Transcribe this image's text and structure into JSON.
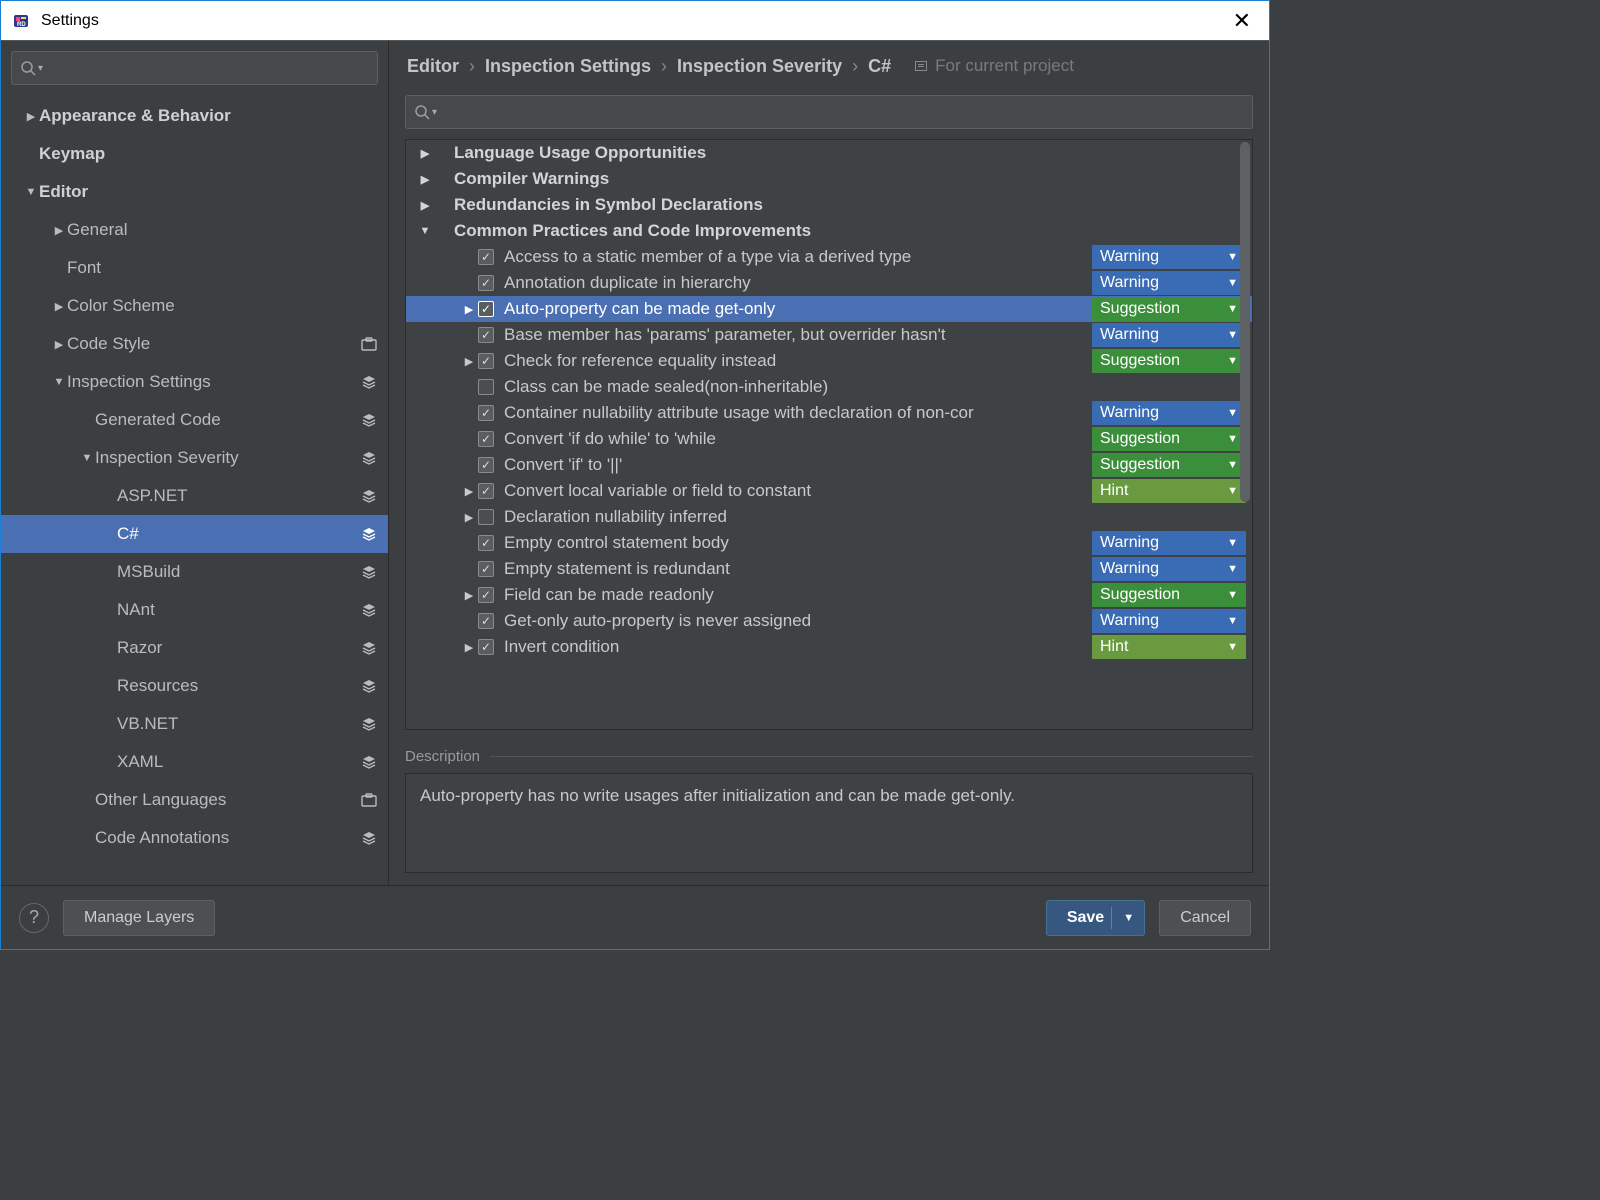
{
  "window": {
    "title": "Settings"
  },
  "sidebar": {
    "search_placeholder": "",
    "items": [
      {
        "label": "Appearance & Behavior",
        "bold": true,
        "expand": "▶",
        "indent": 0
      },
      {
        "label": "Keymap",
        "bold": true,
        "expand": "",
        "indent": 0
      },
      {
        "label": "Editor",
        "bold": true,
        "expand": "▼",
        "indent": 0
      },
      {
        "label": "General",
        "expand": "▶",
        "indent": 1
      },
      {
        "label": "Font",
        "expand": "",
        "indent": 1
      },
      {
        "label": "Color Scheme",
        "expand": "▶",
        "indent": 1
      },
      {
        "label": "Code Style",
        "expand": "▶",
        "indent": 1,
        "badge": "briefcase"
      },
      {
        "label": "Inspection Settings",
        "expand": "▼",
        "indent": 1,
        "badge": "layers"
      },
      {
        "label": "Generated Code",
        "expand": "",
        "indent": 2,
        "badge": "layers"
      },
      {
        "label": "Inspection Severity",
        "expand": "▼",
        "indent": 2,
        "badge": "layers"
      },
      {
        "label": "ASP.NET",
        "expand": "",
        "indent": 3,
        "badge": "layers"
      },
      {
        "label": "C#",
        "expand": "",
        "indent": 3,
        "badge": "layers",
        "selected": true
      },
      {
        "label": "MSBuild",
        "expand": "",
        "indent": 3,
        "badge": "layers"
      },
      {
        "label": "NAnt",
        "expand": "",
        "indent": 3,
        "badge": "layers"
      },
      {
        "label": "Razor",
        "expand": "",
        "indent": 3,
        "badge": "layers"
      },
      {
        "label": "Resources",
        "expand": "",
        "indent": 3,
        "badge": "layers"
      },
      {
        "label": "VB.NET",
        "expand": "",
        "indent": 3,
        "badge": "layers"
      },
      {
        "label": "XAML",
        "expand": "",
        "indent": 3,
        "badge": "layers"
      },
      {
        "label": "Other Languages",
        "expand": "",
        "indent": 2,
        "badge": "briefcase"
      },
      {
        "label": "Code Annotations",
        "expand": "",
        "indent": 2,
        "badge": "layers"
      }
    ]
  },
  "breadcrumb": {
    "parts": [
      "Editor",
      "Inspection Settings",
      "Inspection Severity",
      "C#"
    ],
    "scope": "For current project"
  },
  "categories": [
    {
      "label": "Language Usage Opportunities",
      "expanded": false
    },
    {
      "label": "Compiler Warnings",
      "expanded": false
    },
    {
      "label": "Redundancies in Symbol Declarations",
      "expanded": false
    },
    {
      "label": "Common Practices and Code Improvements",
      "expanded": true
    }
  ],
  "inspections": [
    {
      "label": "Access to a static member of a type via a derived type",
      "checked": true,
      "exp": "",
      "sev": "Warning",
      "sevClass": "warning"
    },
    {
      "label": "Annotation duplicate in hierarchy",
      "checked": true,
      "exp": "",
      "sev": "Warning",
      "sevClass": "warning"
    },
    {
      "label": "Auto-property can be made get-only",
      "checked": true,
      "exp": "▶",
      "sev": "Suggestion",
      "sevClass": "suggestion",
      "selected": true
    },
    {
      "label": "Base member has 'params' parameter, but overrider hasn't",
      "checked": true,
      "exp": "",
      "sev": "Warning",
      "sevClass": "warning"
    },
    {
      "label": "Check for reference equality instead",
      "checked": true,
      "exp": "▶",
      "sev": "Suggestion",
      "sevClass": "suggestion"
    },
    {
      "label": "Class can be made sealed(non-inheritable)",
      "checked": false,
      "exp": "",
      "sev": "",
      "sevClass": "none"
    },
    {
      "label": "Container nullability attribute usage with declaration of non-cor",
      "checked": true,
      "exp": "",
      "sev": "Warning",
      "sevClass": "warning"
    },
    {
      "label": "Convert 'if do while' to 'while",
      "checked": true,
      "exp": "",
      "sev": "Suggestion",
      "sevClass": "suggestion"
    },
    {
      "label": "Convert 'if' to '||'",
      "checked": true,
      "exp": "",
      "sev": "Suggestion",
      "sevClass": "suggestion"
    },
    {
      "label": "Convert local variable or field to constant",
      "checked": true,
      "exp": "▶",
      "sev": "Hint",
      "sevClass": "hint"
    },
    {
      "label": "Declaration nullability inferred",
      "checked": false,
      "exp": "▶",
      "sev": "",
      "sevClass": "none"
    },
    {
      "label": "Empty control statement body",
      "checked": true,
      "exp": "",
      "sev": "Warning",
      "sevClass": "warning"
    },
    {
      "label": "Empty statement is redundant",
      "checked": true,
      "exp": "",
      "sev": "Warning",
      "sevClass": "warning"
    },
    {
      "label": "Field can be made readonly",
      "checked": true,
      "exp": "▶",
      "sev": "Suggestion",
      "sevClass": "suggestion"
    },
    {
      "label": "Get-only auto-property is never assigned",
      "checked": true,
      "exp": "",
      "sev": "Warning",
      "sevClass": "warning"
    },
    {
      "label": "Invert condition",
      "checked": true,
      "exp": "▶",
      "sev": "Hint",
      "sevClass": "hint"
    }
  ],
  "description": {
    "label": "Description",
    "text": "Auto-property has no write usages after initialization and can be made get-only."
  },
  "footer": {
    "help": "?",
    "manage": "Manage Layers",
    "save": "Save",
    "cancel": "Cancel"
  }
}
